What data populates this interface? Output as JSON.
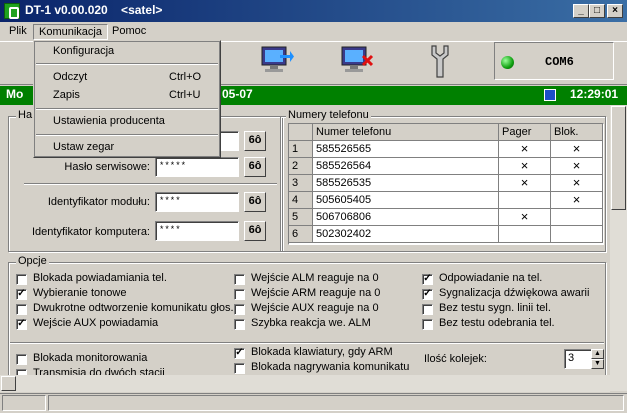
{
  "window": {
    "title": "DT-1 v0.00.020    <satel>"
  },
  "menubar": [
    "Plik",
    "Komunikacja",
    "Pomoc"
  ],
  "menu": {
    "items": [
      {
        "label": "Konfiguracja",
        "shortcut": ""
      },
      {
        "label": "Odczyt",
        "shortcut": "Ctrl+O"
      },
      {
        "label": "Zapis",
        "shortcut": "Ctrl+U"
      },
      {
        "label": "Ustawienia producenta",
        "shortcut": ""
      },
      {
        "label": "Ustaw zegar",
        "shortcut": ""
      }
    ]
  },
  "toolbar": {
    "com_port": "COM6"
  },
  "status": {
    "left": "Mo",
    "date": "05-07",
    "time": "12:29:01"
  },
  "hasla": {
    "title": "Ha",
    "service_label": "Hasło serwisowe:",
    "service_value": "*****",
    "module_label": "Identyfikator modułu:",
    "module_value": "****",
    "computer_label": "Identyfikator komputera:",
    "computer_value": "****",
    "key_glyph": "6ô"
  },
  "phones": {
    "title": "Numery telefonu",
    "headers": [
      "",
      "Numer telefonu",
      "Pager",
      "Blok."
    ],
    "rows": [
      {
        "n": "1",
        "number": "585526565",
        "pager": "×",
        "blok": "×"
      },
      {
        "n": "2",
        "number": "585526564",
        "pager": "×",
        "blok": "×"
      },
      {
        "n": "3",
        "number": "585526535",
        "pager": "×",
        "blok": "×"
      },
      {
        "n": "4",
        "number": "505605405",
        "pager": "",
        "blok": "×"
      },
      {
        "n": "5",
        "number": "506706806",
        "pager": "×",
        "blok": ""
      },
      {
        "n": "6",
        "number": "502302402",
        "pager": "",
        "blok": ""
      }
    ]
  },
  "opcje": {
    "title": "Opcje",
    "col1": [
      {
        "label": "Blokada powiadamiania tel.",
        "checked": false
      },
      {
        "label": "Wybieranie tonowe",
        "checked": true
      },
      {
        "label": "Dwukrotne odtworzenie komunikatu głos.",
        "checked": false
      },
      {
        "label": "Wejście AUX powiadamia",
        "checked": true
      }
    ],
    "col2": [
      {
        "label": "Wejście ALM reaguje na 0",
        "checked": false
      },
      {
        "label": "Wejście ARM reaguje na 0",
        "checked": false
      },
      {
        "label": "Wejście AUX reaguje na 0",
        "checked": false
      },
      {
        "label": "Szybka reakcja we. ALM",
        "checked": false
      }
    ],
    "col3": [
      {
        "label": "Odpowiadanie na tel.",
        "checked": true
      },
      {
        "label": "Sygnalizacja dźwiękowa awarii",
        "checked": true
      },
      {
        "label": "Bez testu sygn. linii tel.",
        "checked": false
      },
      {
        "label": "Bez testu odebrania tel.",
        "checked": false
      }
    ],
    "lower1": [
      {
        "label": "Blokada monitorowania",
        "checked": false
      },
      {
        "label": "Transmisja do dwóch stacji",
        "checked": false
      }
    ],
    "lower2": [
      {
        "label": "Blokada klawiatury, gdy ARM",
        "checked": true
      },
      {
        "label": "Blokada nagrywania komunikatu",
        "checked": false
      }
    ],
    "kolejek_label": "Ilość kolejek:",
    "kolejek_value": "3"
  }
}
